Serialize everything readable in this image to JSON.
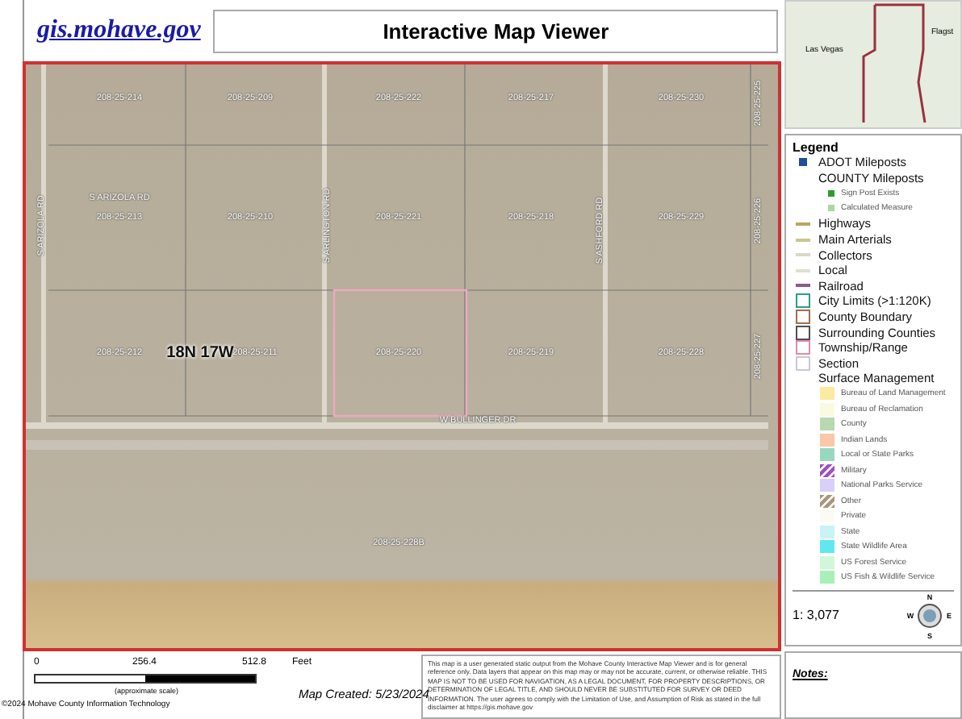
{
  "header": {
    "site_link": "gis.mohave.gov",
    "title": "Interactive Map Viewer"
  },
  "map": {
    "labels": [
      {
        "text": "208-25-214",
        "kind": "parcel"
      },
      {
        "text": "208-25-209",
        "kind": "parcel"
      },
      {
        "text": "208-25-222",
        "kind": "parcel"
      },
      {
        "text": "208-25-217",
        "kind": "parcel"
      },
      {
        "text": "208-25-230",
        "kind": "parcel"
      },
      {
        "text": "S ARIZOLA RD",
        "kind": "road"
      },
      {
        "text": "208-25-213",
        "kind": "parcel"
      },
      {
        "text": "208-25-210",
        "kind": "parcel"
      },
      {
        "text": "208-25-221",
        "kind": "parcel"
      },
      {
        "text": "208-25-218",
        "kind": "parcel"
      },
      {
        "text": "208-25-229",
        "kind": "parcel"
      },
      {
        "text": "208-25-212",
        "kind": "parcel"
      },
      {
        "text": "18N 17W",
        "kind": "township"
      },
      {
        "text": "208-25-211",
        "kind": "parcel"
      },
      {
        "text": "208-25-220",
        "kind": "parcel"
      },
      {
        "text": "208-25-219",
        "kind": "parcel"
      },
      {
        "text": "208-25-228",
        "kind": "parcel"
      },
      {
        "text": "W BULLINGER DR",
        "kind": "road"
      },
      {
        "text": "208-25-228B",
        "kind": "parcel"
      },
      {
        "text": "S ARIZOLA RD",
        "kind": "road_vertical"
      },
      {
        "text": "S ARLINGTON RD",
        "kind": "road_vertical"
      },
      {
        "text": "S ASHFORD RD",
        "kind": "road_vertical"
      },
      {
        "text": "208-25-225",
        "kind": "parcel_vertical"
      },
      {
        "text": "208-25-226",
        "kind": "parcel_vertical"
      },
      {
        "text": "208-25-227",
        "kind": "parcel_vertical"
      }
    ]
  },
  "footer": {
    "scale_ticks": [
      "0",
      "256.4",
      "512.8"
    ],
    "scale_unit": "Feet",
    "scale_note": "(approximate scale)",
    "map_created": "Map Created: 5/23/2024",
    "copyright": "©2024 Mohave County Information Technology",
    "disclaimer": "This map is a user generated static output from the Mohave County Interactive Map Viewer and is for general reference only. Data layers that appear on this map may or may not be accurate, current, or otherwise reliable. THIS MAP IS NOT TO BE USED FOR NAVIGATION, AS A LEGAL DOCUMENT, FOR PROPERTY DESCRIPTIONS, OR DETERMINATION OF LEGAL TITLE, AND SHOULD NEVER BE SUBSTITUTED FOR SURVEY OR DEED INFORMATION. The user agrees to comply with the Limitation of Use, and Assumption of Risk as stated in the full disclaimer at https://gis.mohave.gov"
  },
  "overview": {
    "labels": [
      "Las Vegas",
      "Flagst"
    ]
  },
  "legend": {
    "title": "Legend",
    "items": [
      {
        "label": "ADOT Mileposts",
        "kind": "point",
        "color": "#1f4e9a"
      },
      {
        "label": "COUNTY Mileposts",
        "kind": "heading"
      },
      {
        "label": "Sign Post Exists",
        "kind": "subpoint",
        "color": "#2e9b2e"
      },
      {
        "label": "Calculated Measure",
        "kind": "subpoint",
        "color": "#a8d8a0"
      },
      {
        "label": "Highways",
        "kind": "line",
        "color": "#b8a860"
      },
      {
        "label": "Main Arterials",
        "kind": "line",
        "color": "#c8c890"
      },
      {
        "label": "Collectors",
        "kind": "line",
        "color": "#d8d8c8"
      },
      {
        "label": "Local",
        "kind": "line",
        "color": "#e0e0d0"
      },
      {
        "label": "Railroad",
        "kind": "line",
        "color": "#8a5a8a"
      },
      {
        "label": "City Limits (>1:120K)",
        "kind": "outline",
        "color": "#2aa08a"
      },
      {
        "label": "County Boundary",
        "kind": "outline",
        "color": "#a0704a"
      },
      {
        "label": "Surrounding Counties",
        "kind": "outline",
        "color": "#505050"
      },
      {
        "label": "Township/Range",
        "kind": "outline",
        "color": "#e08aa8"
      },
      {
        "label": "Section",
        "kind": "outline",
        "color": "#c8c8d8"
      },
      {
        "label": "Surface Management",
        "kind": "heading"
      },
      {
        "label": "Bureau of Land Management",
        "kind": "fill",
        "color": "#fbeaa0"
      },
      {
        "label": "Bureau of Reclamation",
        "kind": "fill",
        "color": "#fafae0"
      },
      {
        "label": "County",
        "kind": "fill",
        "color": "#b8d8b0"
      },
      {
        "label": "Indian Lands",
        "kind": "fill",
        "color": "#f8c8a8"
      },
      {
        "label": "Local or State Parks",
        "kind": "fill",
        "color": "#98d8c0"
      },
      {
        "label": "Military",
        "kind": "hatch",
        "color": "#a050c0"
      },
      {
        "label": "National Parks Service",
        "kind": "fill",
        "color": "#d8d0f8"
      },
      {
        "label": "Other",
        "kind": "hatch",
        "color": "#a89878"
      },
      {
        "label": "Private",
        "kind": "fill",
        "color": "#fbfbf4"
      },
      {
        "label": "State",
        "kind": "fill",
        "color": "#c8f4f4"
      },
      {
        "label": "State Wildlife Area",
        "kind": "fill",
        "color": "#60e8f0"
      },
      {
        "label": "US Forest Service",
        "kind": "fill",
        "color": "#d0f8d8"
      },
      {
        "label": "US Fish & Wildlife Service",
        "kind": "fill",
        "color": "#a8f0b8"
      }
    ],
    "scale": "1: 3,077",
    "compass": [
      "N",
      "E",
      "S",
      "W"
    ]
  },
  "notes": {
    "title": "Notes:"
  }
}
